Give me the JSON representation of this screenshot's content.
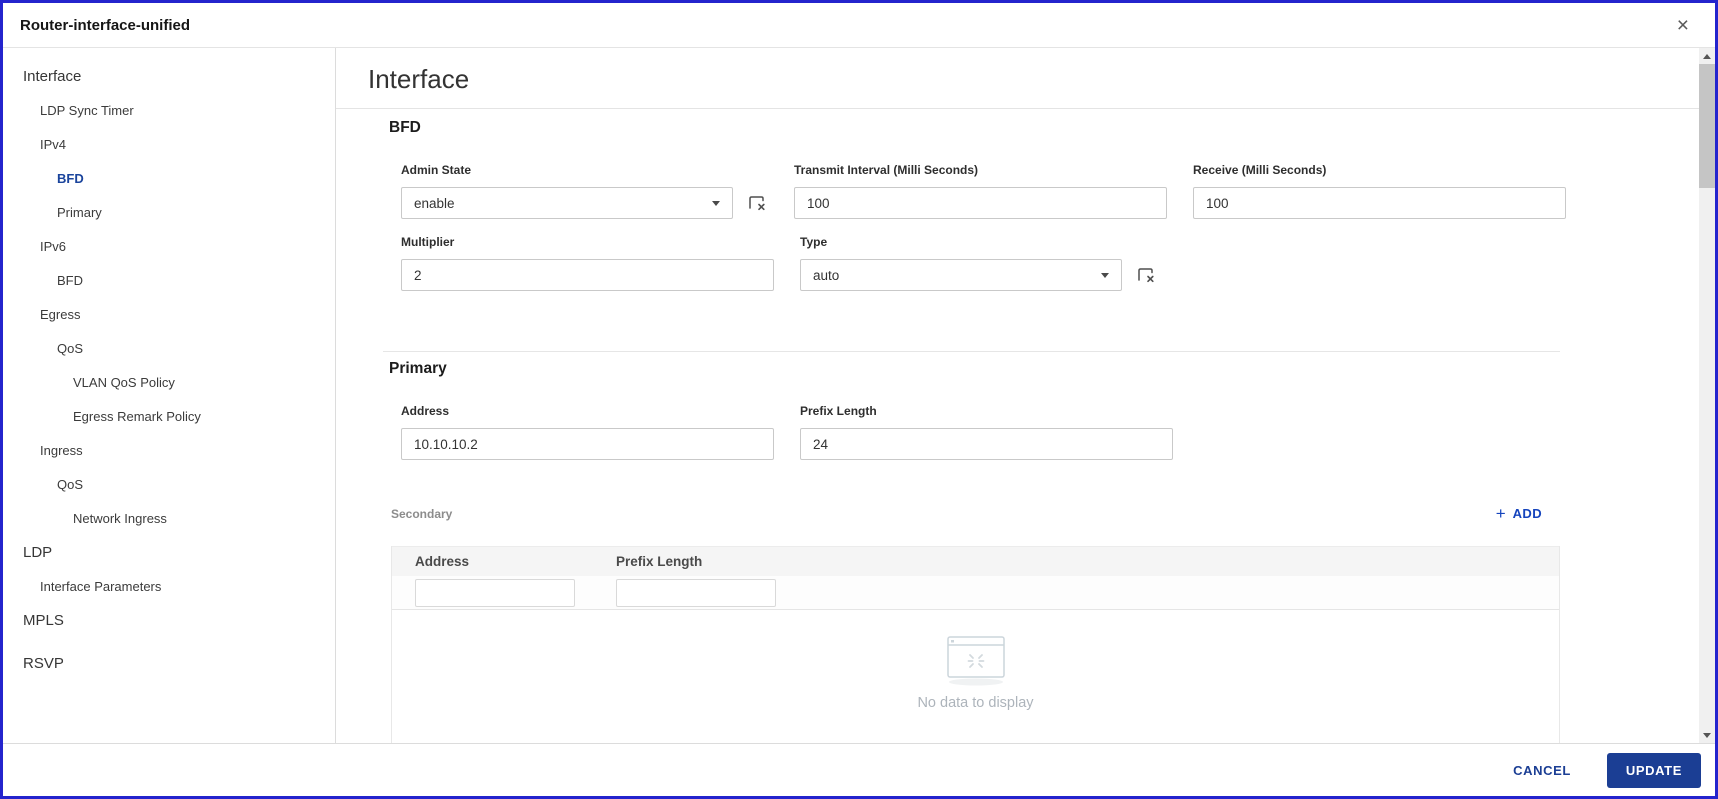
{
  "window": {
    "title": "Router-interface-unified"
  },
  "icons": {
    "close": "×",
    "add_plus": "+"
  },
  "colors": {
    "window_border": "#2424cd",
    "selected_nav_item": "#1a449c",
    "action_blue": "#1b3e94",
    "add_link_blue": "#1544bd",
    "table_header_bg": "#f5f5f5",
    "empty_state_gray": "#adb4bb"
  },
  "sidebar": {
    "items": [
      {
        "label": "Interface",
        "level": 0,
        "selected": false
      },
      {
        "label": "LDP Sync Timer",
        "level": 1,
        "selected": false
      },
      {
        "label": "IPv4",
        "level": 1,
        "selected": false
      },
      {
        "label": "BFD",
        "level": 2,
        "selected": true
      },
      {
        "label": "Primary",
        "level": 2,
        "selected": false
      },
      {
        "label": "IPv6",
        "level": 1,
        "selected": false
      },
      {
        "label": "BFD",
        "level": 2,
        "selected": false
      },
      {
        "label": "Egress",
        "level": 1,
        "selected": false
      },
      {
        "label": "QoS",
        "level": 2,
        "selected": false
      },
      {
        "label": "VLAN QoS Policy",
        "level": 3,
        "selected": false
      },
      {
        "label": "Egress Remark Policy",
        "level": 3,
        "selected": false
      },
      {
        "label": "Ingress",
        "level": 1,
        "selected": false
      },
      {
        "label": "QoS",
        "level": 2,
        "selected": false
      },
      {
        "label": "Network Ingress",
        "level": 3,
        "selected": false
      },
      {
        "label": "LDP",
        "level": 0,
        "selected": false
      },
      {
        "label": "Interface Parameters",
        "level": 1,
        "selected": false
      },
      {
        "label": "MPLS",
        "level": 0,
        "selected": false
      },
      {
        "label": "RSVP",
        "level": 0,
        "selected": false,
        "gap_before": true
      }
    ]
  },
  "main": {
    "title": "Interface",
    "bfd": {
      "heading": "BFD",
      "admin_state": {
        "label": "Admin State",
        "value": "enable"
      },
      "transmit": {
        "label": "Transmit Interval (Milli Seconds)",
        "value": "100"
      },
      "receive": {
        "label": "Receive (Milli Seconds)",
        "value": "100"
      },
      "multiplier": {
        "label": "Multiplier",
        "value": "2"
      },
      "type": {
        "label": "Type",
        "value": "auto"
      }
    },
    "primary": {
      "heading": "Primary",
      "address": {
        "label": "Address",
        "value": "10.10.10.2"
      },
      "prefix_length": {
        "label": "Prefix Length",
        "value": "24"
      }
    },
    "secondary": {
      "heading": "Secondary",
      "add_label": "ADD",
      "table": {
        "columns": [
          "Address",
          "Prefix Length"
        ],
        "filter_values": [
          "",
          ""
        ],
        "empty_message": "No data to display"
      }
    }
  },
  "footer": {
    "cancel": "CANCEL",
    "update": "UPDATE"
  }
}
